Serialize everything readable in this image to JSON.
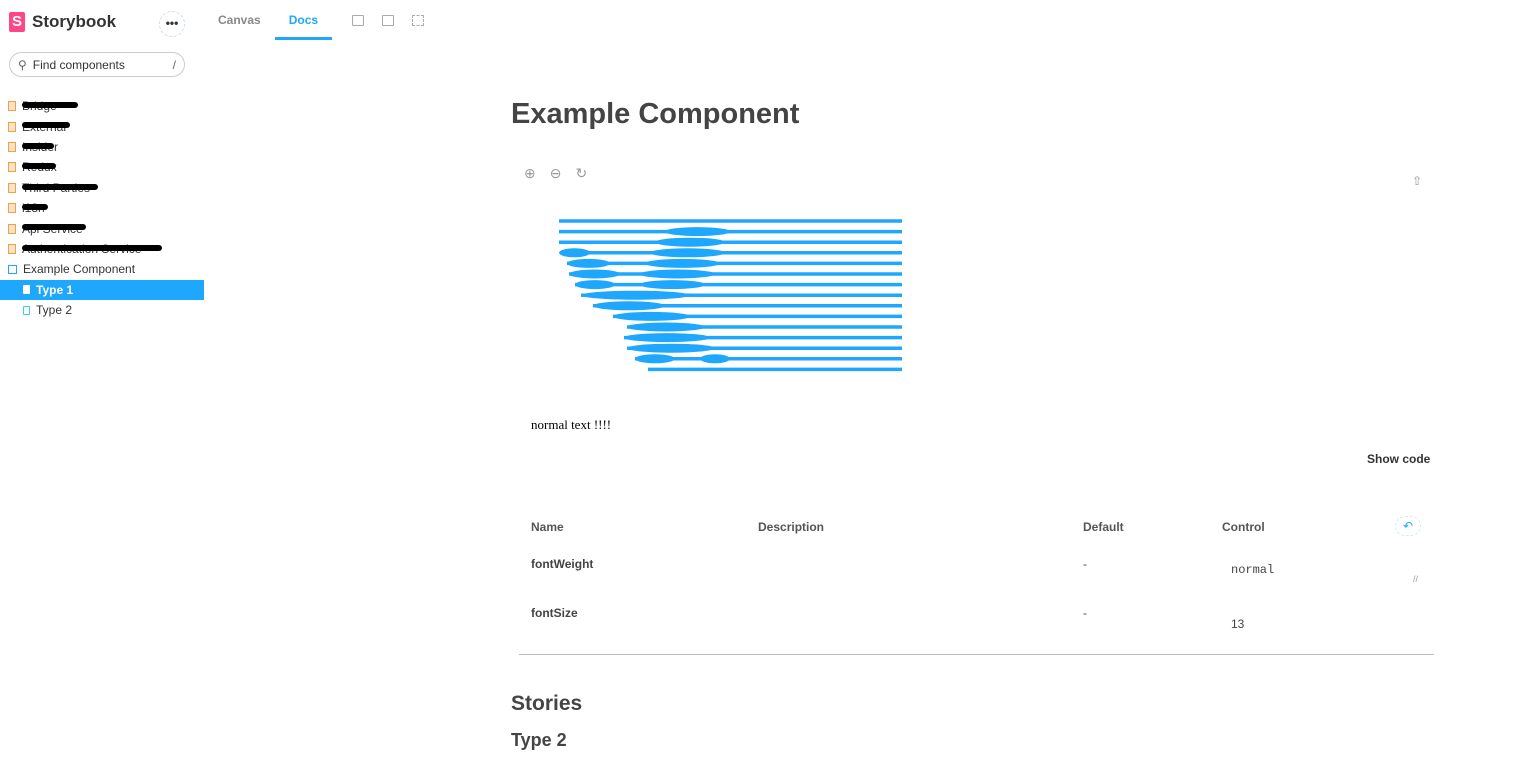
{
  "app": {
    "name": "Storybook",
    "menu": "•••"
  },
  "search": {
    "placeholder": "Find components",
    "shortcut": "/"
  },
  "sidebar": {
    "items": [
      {
        "label": "Bridge",
        "redacted": true
      },
      {
        "label": "External",
        "redacted": true
      },
      {
        "label": "Insider",
        "redacted": true
      },
      {
        "label": "Redux",
        "redacted": true
      },
      {
        "label": "Third Parties",
        "redacted": true
      },
      {
        "label": "i18n",
        "redacted": true
      },
      {
        "label": "Api Service",
        "redacted": true
      },
      {
        "label": "Authentication Service",
        "redacted": true
      },
      {
        "label": "Example Component"
      },
      {
        "label": "Type 1",
        "selected": true
      },
      {
        "label": "Type 2"
      }
    ]
  },
  "tabs": [
    {
      "label": "Canvas"
    },
    {
      "label": "Docs",
      "active": true
    }
  ],
  "docs": {
    "title": "Example Component",
    "preview_text": "normal text !!!!",
    "show_code": "Show code",
    "table": {
      "headers": [
        "Name",
        "Description",
        "Default",
        "Control"
      ],
      "rows": [
        {
          "name": "fontWeight",
          "default": "-",
          "control": "normal"
        },
        {
          "name": "fontSize",
          "default": "-",
          "control": "13"
        }
      ]
    },
    "stories_heading": "Stories",
    "story_heading": "Type 2"
  },
  "colors": {
    "accent": "#1ea7fd",
    "brand": "#ff4785"
  }
}
